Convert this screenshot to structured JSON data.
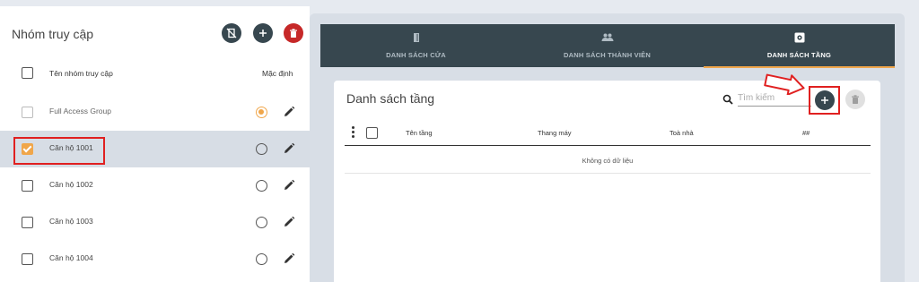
{
  "left_panel": {
    "title": "Nhóm truy cập",
    "header": {
      "name_col": "Tên nhóm truy cập",
      "default_col": "Mặc định"
    },
    "rows": [
      {
        "label": "Full Access Group",
        "checked": false,
        "default": true
      },
      {
        "label": "Căn hộ 1001",
        "checked": true,
        "default": false
      },
      {
        "label": "Căn hộ 1002",
        "checked": false,
        "default": false
      },
      {
        "label": "Căn hộ 1003",
        "checked": false,
        "default": false
      },
      {
        "label": "Căn hộ 1004",
        "checked": false,
        "default": false
      }
    ],
    "icons": {
      "toolbar": [
        "no-door-icon",
        "add-icon",
        "delete-icon"
      ],
      "row_edit": "pencil-icon"
    }
  },
  "tabs": [
    {
      "label": "DANH SÁCH CỬA",
      "icon": "door-icon",
      "active": false
    },
    {
      "label": "DANH SÁCH THÀNH VIÊN",
      "icon": "people-icon",
      "active": false
    },
    {
      "label": "DANH SÁCH TẦNG",
      "icon": "gear-box-icon",
      "active": true
    }
  ],
  "floor_card": {
    "title": "Danh sách tầng",
    "search_placeholder": "Tìm kiếm",
    "columns": [
      "Tên tầng",
      "Thang máy",
      "Toà nhà",
      "##"
    ],
    "empty_text": "Không có dữ liệu"
  },
  "colors": {
    "dark_slate": "#37474f",
    "accent_orange": "#f0a64a",
    "danger_red": "#c62828",
    "annotation_red": "#e02020"
  }
}
